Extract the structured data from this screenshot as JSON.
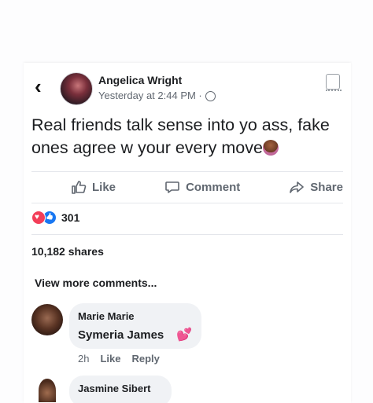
{
  "post": {
    "author": "Angelica Wright",
    "timestamp": "Yesterday at 2:44 PM ·",
    "privacy_icon": "globe-icon",
    "text": "Real friends talk sense into yo ass, fake ones agree w your every move"
  },
  "actions": {
    "like": "Like",
    "comment": "Comment",
    "share": "Share"
  },
  "stats": {
    "reaction_count": "301",
    "shares": "10,182 shares"
  },
  "comments": {
    "view_more": "View more comments...",
    "items": [
      {
        "author": "Marie Marie",
        "text": "Symeria James",
        "time": "2h",
        "like": "Like",
        "reply": "Reply"
      },
      {
        "author": "Jasmine Sibert"
      }
    ]
  },
  "colors": {
    "secondary_text": "#606770",
    "like_blue": "#1877f2",
    "love_red": "#f33e58",
    "bubble": "#f0f2f5"
  }
}
